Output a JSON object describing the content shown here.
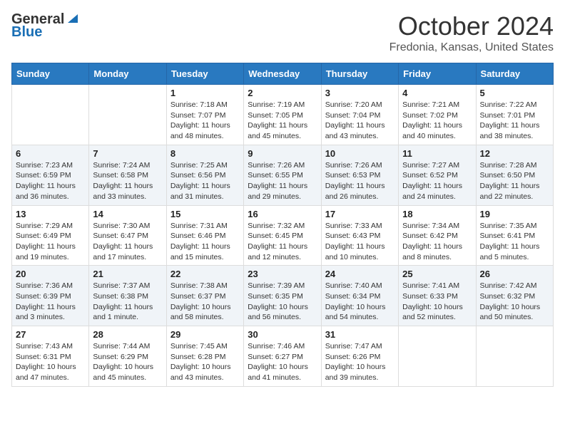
{
  "header": {
    "logo_general": "General",
    "logo_blue": "Blue",
    "month_title": "October 2024",
    "location": "Fredonia, Kansas, United States"
  },
  "weekdays": [
    "Sunday",
    "Monday",
    "Tuesday",
    "Wednesday",
    "Thursday",
    "Friday",
    "Saturday"
  ],
  "weeks": [
    [
      {
        "day": "",
        "info": ""
      },
      {
        "day": "",
        "info": ""
      },
      {
        "day": "1",
        "info": "Sunrise: 7:18 AM\nSunset: 7:07 PM\nDaylight: 11 hours and 48 minutes."
      },
      {
        "day": "2",
        "info": "Sunrise: 7:19 AM\nSunset: 7:05 PM\nDaylight: 11 hours and 45 minutes."
      },
      {
        "day": "3",
        "info": "Sunrise: 7:20 AM\nSunset: 7:04 PM\nDaylight: 11 hours and 43 minutes."
      },
      {
        "day": "4",
        "info": "Sunrise: 7:21 AM\nSunset: 7:02 PM\nDaylight: 11 hours and 40 minutes."
      },
      {
        "day": "5",
        "info": "Sunrise: 7:22 AM\nSunset: 7:01 PM\nDaylight: 11 hours and 38 minutes."
      }
    ],
    [
      {
        "day": "6",
        "info": "Sunrise: 7:23 AM\nSunset: 6:59 PM\nDaylight: 11 hours and 36 minutes."
      },
      {
        "day": "7",
        "info": "Sunrise: 7:24 AM\nSunset: 6:58 PM\nDaylight: 11 hours and 33 minutes."
      },
      {
        "day": "8",
        "info": "Sunrise: 7:25 AM\nSunset: 6:56 PM\nDaylight: 11 hours and 31 minutes."
      },
      {
        "day": "9",
        "info": "Sunrise: 7:26 AM\nSunset: 6:55 PM\nDaylight: 11 hours and 29 minutes."
      },
      {
        "day": "10",
        "info": "Sunrise: 7:26 AM\nSunset: 6:53 PM\nDaylight: 11 hours and 26 minutes."
      },
      {
        "day": "11",
        "info": "Sunrise: 7:27 AM\nSunset: 6:52 PM\nDaylight: 11 hours and 24 minutes."
      },
      {
        "day": "12",
        "info": "Sunrise: 7:28 AM\nSunset: 6:50 PM\nDaylight: 11 hours and 22 minutes."
      }
    ],
    [
      {
        "day": "13",
        "info": "Sunrise: 7:29 AM\nSunset: 6:49 PM\nDaylight: 11 hours and 19 minutes."
      },
      {
        "day": "14",
        "info": "Sunrise: 7:30 AM\nSunset: 6:47 PM\nDaylight: 11 hours and 17 minutes."
      },
      {
        "day": "15",
        "info": "Sunrise: 7:31 AM\nSunset: 6:46 PM\nDaylight: 11 hours and 15 minutes."
      },
      {
        "day": "16",
        "info": "Sunrise: 7:32 AM\nSunset: 6:45 PM\nDaylight: 11 hours and 12 minutes."
      },
      {
        "day": "17",
        "info": "Sunrise: 7:33 AM\nSunset: 6:43 PM\nDaylight: 11 hours and 10 minutes."
      },
      {
        "day": "18",
        "info": "Sunrise: 7:34 AM\nSunset: 6:42 PM\nDaylight: 11 hours and 8 minutes."
      },
      {
        "day": "19",
        "info": "Sunrise: 7:35 AM\nSunset: 6:41 PM\nDaylight: 11 hours and 5 minutes."
      }
    ],
    [
      {
        "day": "20",
        "info": "Sunrise: 7:36 AM\nSunset: 6:39 PM\nDaylight: 11 hours and 3 minutes."
      },
      {
        "day": "21",
        "info": "Sunrise: 7:37 AM\nSunset: 6:38 PM\nDaylight: 11 hours and 1 minute."
      },
      {
        "day": "22",
        "info": "Sunrise: 7:38 AM\nSunset: 6:37 PM\nDaylight: 10 hours and 58 minutes."
      },
      {
        "day": "23",
        "info": "Sunrise: 7:39 AM\nSunset: 6:35 PM\nDaylight: 10 hours and 56 minutes."
      },
      {
        "day": "24",
        "info": "Sunrise: 7:40 AM\nSunset: 6:34 PM\nDaylight: 10 hours and 54 minutes."
      },
      {
        "day": "25",
        "info": "Sunrise: 7:41 AM\nSunset: 6:33 PM\nDaylight: 10 hours and 52 minutes."
      },
      {
        "day": "26",
        "info": "Sunrise: 7:42 AM\nSunset: 6:32 PM\nDaylight: 10 hours and 50 minutes."
      }
    ],
    [
      {
        "day": "27",
        "info": "Sunrise: 7:43 AM\nSunset: 6:31 PM\nDaylight: 10 hours and 47 minutes."
      },
      {
        "day": "28",
        "info": "Sunrise: 7:44 AM\nSunset: 6:29 PM\nDaylight: 10 hours and 45 minutes."
      },
      {
        "day": "29",
        "info": "Sunrise: 7:45 AM\nSunset: 6:28 PM\nDaylight: 10 hours and 43 minutes."
      },
      {
        "day": "30",
        "info": "Sunrise: 7:46 AM\nSunset: 6:27 PM\nDaylight: 10 hours and 41 minutes."
      },
      {
        "day": "31",
        "info": "Sunrise: 7:47 AM\nSunset: 6:26 PM\nDaylight: 10 hours and 39 minutes."
      },
      {
        "day": "",
        "info": ""
      },
      {
        "day": "",
        "info": ""
      }
    ]
  ]
}
